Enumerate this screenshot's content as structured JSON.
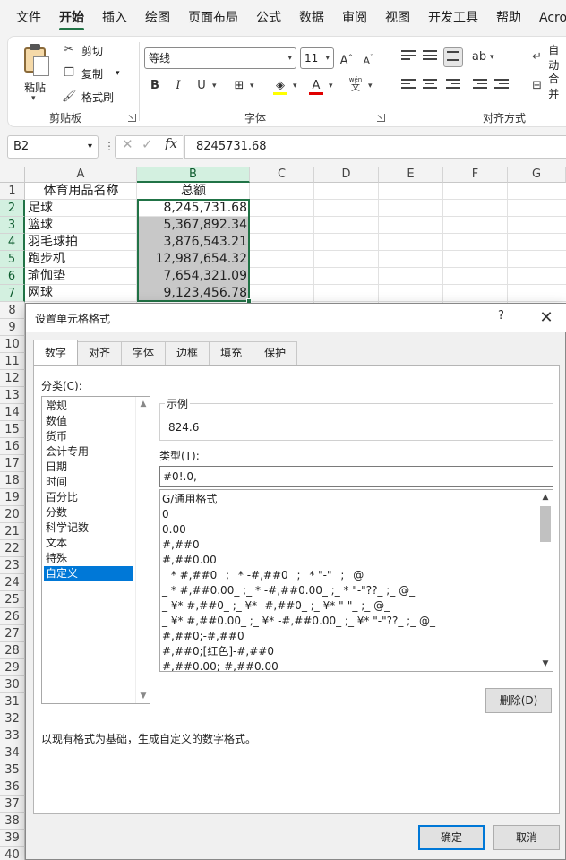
{
  "menu": [
    "文件",
    "开始",
    "插入",
    "绘图",
    "页面布局",
    "公式",
    "数据",
    "审阅",
    "视图",
    "开发工具",
    "帮助",
    "Acrobat"
  ],
  "ribbon": {
    "clipboard": {
      "paste": "粘贴",
      "cut": "剪切",
      "copy": "复制",
      "format_painter": "格式刷",
      "label": "剪贴板"
    },
    "font": {
      "name": "等线",
      "size": "11",
      "label": "字体",
      "bold": "B",
      "italic": "I",
      "underline": "U",
      "font_color_glyph": "A",
      "wen": "wén",
      "wen_char": "文"
    },
    "alignment": {
      "label": "对齐方式",
      "wrap": "自动",
      "merge": "合并"
    }
  },
  "formula_bar": {
    "name_box": "B2",
    "formula": "8245731.68",
    "fx": "fx"
  },
  "grid": {
    "columns": [
      "A",
      "B",
      "C",
      "D",
      "E",
      "F",
      "G"
    ],
    "rows": [
      "1",
      "2",
      "3",
      "4",
      "5",
      "6",
      "7",
      "8",
      "9",
      "10",
      "11",
      "12",
      "13",
      "14",
      "15",
      "16",
      "17",
      "18",
      "19",
      "20",
      "21",
      "22",
      "23",
      "24",
      "25",
      "26",
      "27",
      "28",
      "29",
      "30",
      "31",
      "32",
      "33",
      "34",
      "35",
      "36",
      "37",
      "38",
      "39",
      "40"
    ],
    "header": {
      "a": "体育用品名称",
      "b": "总额"
    },
    "data": [
      {
        "name": "足球",
        "amount": "8,245,731.68"
      },
      {
        "name": "篮球",
        "amount": "5,367,892.34"
      },
      {
        "name": "羽毛球拍",
        "amount": "3,876,543.21"
      },
      {
        "name": "跑步机",
        "amount": "12,987,654.32"
      },
      {
        "name": "瑜伽垫",
        "amount": "7,654,321.09"
      },
      {
        "name": "网球",
        "amount": "9,123,456.78"
      }
    ]
  },
  "dialog": {
    "title": "设置单元格格式",
    "help": "?",
    "close": "✕",
    "tabs": [
      "数字",
      "对齐",
      "字体",
      "边框",
      "填充",
      "保护"
    ],
    "category_label": "分类(C):",
    "categories": [
      "常规",
      "数值",
      "货币",
      "会计专用",
      "日期",
      "时间",
      "百分比",
      "分数",
      "科学记数",
      "文本",
      "特殊",
      "自定义"
    ],
    "sample_label": "示例",
    "sample_value": "824.6",
    "type_label": "类型(T):",
    "type_value": "#0!.0,",
    "formats": [
      "G/通用格式",
      "0",
      "0.00",
      "#,##0",
      "#,##0.00",
      "_ * #,##0_ ;_ * -#,##0_ ;_ * \"-\"_ ;_ @_",
      "_ * #,##0.00_ ;_ * -#,##0.00_ ;_ * \"-\"??_ ;_ @_",
      "_ ¥* #,##0_ ;_ ¥* -#,##0_ ;_ ¥* \"-\"_ ;_ @_",
      "_ ¥* #,##0.00_ ;_ ¥* -#,##0.00_ ;_ ¥* \"-\"??_ ;_ @_",
      "#,##0;-#,##0",
      "#,##0;[红色]-#,##0",
      "#,##0.00;-#,##0.00"
    ],
    "delete_button": "删除(D)",
    "description": "以现有格式为基础，生成自定义的数字格式。",
    "ok_button": "确定",
    "cancel_button": "取消"
  }
}
